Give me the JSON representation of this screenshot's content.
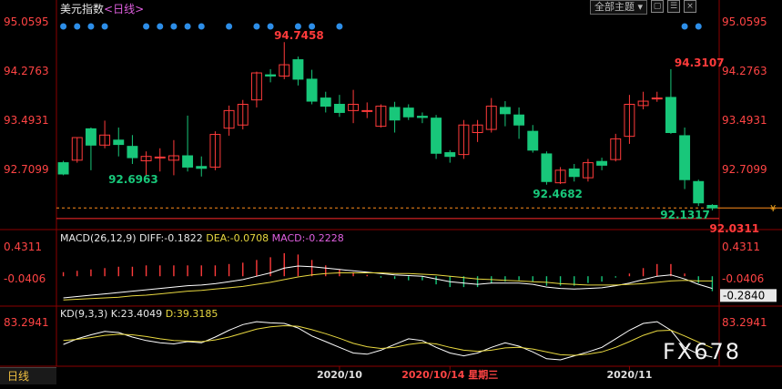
{
  "header": {
    "title": "美元指数",
    "period": "<日线>",
    "theme_label": "全部主题",
    "theme_arrow": "▾"
  },
  "colors": {
    "up": "#ff3b3b",
    "down": "#18c77a",
    "price_axis": "#ff4444",
    "diff": "#ffffff",
    "dea": "#e8d840",
    "macd": "#e060e0",
    "event_dot": "#2d8ee8"
  },
  "footer": {
    "tab_label": "日线",
    "watermark": "FX678"
  },
  "chart_data": [
    {
      "type": "candlestick",
      "title": "美元指数<日线>",
      "y_ticks": [
        95.0595,
        94.2763,
        93.4931,
        92.7099
      ],
      "ylim": [
        91.9,
        95.15
      ],
      "current_price": "92.0311",
      "reference_line": 91.93,
      "annotations": [
        {
          "text": "94.7458",
          "value": 94.7458,
          "index": 15
        },
        {
          "text": "92.6963",
          "value": 92.6963,
          "index": 3
        },
        {
          "text": "92.4682",
          "value": 92.4682,
          "index": 34
        },
        {
          "text": "94.3107",
          "value": 94.3107,
          "index": 44
        },
        {
          "text": "92.1317",
          "value": 92.1317,
          "index": 46
        },
        {
          "text": "92.0311",
          "value": 92.0311,
          "index": 47
        }
      ],
      "event_dot_indices": [
        0,
        1,
        2,
        3,
        6,
        7,
        8,
        9,
        10,
        12,
        14,
        15,
        17,
        18,
        20,
        45,
        46
      ],
      "x_labels": [
        {
          "text": "2020/10",
          "index": 20
        },
        {
          "text": "2020/10/14 星期三",
          "index": 28
        },
        {
          "text": "2020/11",
          "index": 41
        }
      ],
      "candles": [
        {
          "o": 92.82,
          "h": 92.85,
          "c": 92.64,
          "l": 92.62
        },
        {
          "o": 92.86,
          "h": 93.22,
          "c": 93.22,
          "l": 92.82
        },
        {
          "o": 93.36,
          "h": 93.38,
          "c": 93.1,
          "l": 92.7
        },
        {
          "o": 93.1,
          "h": 93.49,
          "c": 93.26,
          "l": 93.05
        },
        {
          "o": 93.18,
          "h": 93.38,
          "c": 93.11,
          "l": 92.92
        },
        {
          "o": 93.08,
          "h": 93.26,
          "c": 92.9,
          "l": 92.8
        },
        {
          "o": 92.85,
          "h": 93.0,
          "c": 92.92,
          "l": 92.62
        },
        {
          "o": 92.9,
          "h": 93.05,
          "c": 92.91,
          "l": 92.68
        },
        {
          "o": 92.86,
          "h": 93.18,
          "c": 92.93,
          "l": 92.62
        },
        {
          "o": 92.93,
          "h": 93.57,
          "c": 92.75,
          "l": 92.68
        },
        {
          "o": 92.76,
          "h": 92.92,
          "c": 92.73,
          "l": 92.6
        },
        {
          "o": 92.75,
          "h": 93.32,
          "c": 93.27,
          "l": 92.7
        },
        {
          "o": 93.37,
          "h": 93.73,
          "c": 93.65,
          "l": 93.25
        },
        {
          "o": 93.42,
          "h": 93.82,
          "c": 93.75,
          "l": 93.35
        },
        {
          "o": 93.82,
          "h": 94.27,
          "c": 94.25,
          "l": 93.7
        },
        {
          "o": 94.22,
          "h": 94.31,
          "c": 94.2,
          "l": 94.1
        },
        {
          "o": 94.2,
          "h": 94.74,
          "c": 94.38,
          "l": 94.15
        },
        {
          "o": 94.46,
          "h": 94.51,
          "c": 94.15,
          "l": 94.05
        },
        {
          "o": 94.15,
          "h": 94.3,
          "c": 93.8,
          "l": 93.75
        },
        {
          "o": 93.85,
          "h": 93.95,
          "c": 93.72,
          "l": 93.62
        },
        {
          "o": 93.75,
          "h": 93.9,
          "c": 93.62,
          "l": 93.55
        },
        {
          "o": 93.65,
          "h": 93.98,
          "c": 93.75,
          "l": 93.45
        },
        {
          "o": 93.65,
          "h": 93.78,
          "c": 93.65,
          "l": 93.53
        },
        {
          "o": 93.4,
          "h": 93.75,
          "c": 93.72,
          "l": 93.38
        },
        {
          "o": 93.7,
          "h": 93.79,
          "c": 93.5,
          "l": 93.3
        },
        {
          "o": 93.69,
          "h": 93.75,
          "c": 93.55,
          "l": 93.5
        },
        {
          "o": 93.56,
          "h": 93.62,
          "c": 93.54,
          "l": 93.45
        },
        {
          "o": 93.53,
          "h": 93.58,
          "c": 92.97,
          "l": 92.88
        },
        {
          "o": 92.98,
          "h": 93.02,
          "c": 92.92,
          "l": 92.82
        },
        {
          "o": 92.95,
          "h": 93.5,
          "c": 93.42,
          "l": 92.88
        },
        {
          "o": 93.3,
          "h": 93.5,
          "c": 93.42,
          "l": 93.15
        },
        {
          "o": 93.35,
          "h": 93.85,
          "c": 93.72,
          "l": 93.3
        },
        {
          "o": 93.7,
          "h": 93.8,
          "c": 93.6,
          "l": 93.4
        },
        {
          "o": 93.58,
          "h": 93.7,
          "c": 93.42,
          "l": 93.2
        },
        {
          "o": 93.32,
          "h": 93.42,
          "c": 93.02,
          "l": 92.98
        },
        {
          "o": 92.96,
          "h": 93.0,
          "c": 92.52,
          "l": 92.47
        },
        {
          "o": 92.5,
          "h": 92.75,
          "c": 92.7,
          "l": 92.48
        },
        {
          "o": 92.72,
          "h": 92.8,
          "c": 92.6,
          "l": 92.52
        },
        {
          "o": 92.58,
          "h": 92.88,
          "c": 92.82,
          "l": 92.52
        },
        {
          "o": 92.84,
          "h": 92.9,
          "c": 92.78,
          "l": 92.7
        },
        {
          "o": 92.87,
          "h": 93.28,
          "c": 93.2,
          "l": 92.84
        },
        {
          "o": 93.24,
          "h": 93.9,
          "c": 93.75,
          "l": 93.12
        },
        {
          "o": 93.73,
          "h": 93.95,
          "c": 93.8,
          "l": 93.67
        },
        {
          "o": 93.85,
          "h": 93.95,
          "c": 93.85,
          "l": 93.79
        },
        {
          "o": 93.86,
          "h": 94.31,
          "c": 93.3,
          "l": 93.28
        },
        {
          "o": 93.25,
          "h": 93.38,
          "c": 92.55,
          "l": 92.4
        },
        {
          "o": 92.52,
          "h": 92.55,
          "c": 92.18,
          "l": 92.13
        },
        {
          "o": 92.14,
          "h": 92.16,
          "c": 92.1,
          "l": 92.06
        }
      ]
    },
    {
      "type": "macd",
      "label": "MACD(26,12,9)",
      "diff_label": "DIFF:-0.1822",
      "dea_label": "DEA:-0.0708",
      "macd_label": "MACD:-0.2228",
      "y_ticks_right": [
        "0.4311",
        "-0.0406",
        "-0.2840"
      ],
      "y_ticks_left": [
        "0.4311",
        "-0.0406"
      ],
      "ylim": [
        -0.36,
        0.5
      ],
      "diff": [
        -0.32,
        -0.3,
        -0.28,
        -0.26,
        -0.24,
        -0.22,
        -0.2,
        -0.18,
        -0.16,
        -0.14,
        -0.13,
        -0.11,
        -0.08,
        -0.05,
        0.0,
        0.05,
        0.12,
        0.15,
        0.14,
        0.12,
        0.1,
        0.08,
        0.06,
        0.04,
        0.02,
        0.01,
        0.0,
        -0.04,
        -0.08,
        -0.1,
        -0.12,
        -0.1,
        -0.1,
        -0.1,
        -0.12,
        -0.16,
        -0.18,
        -0.19,
        -0.18,
        -0.17,
        -0.14,
        -0.1,
        -0.05,
        0.0,
        0.02,
        -0.04,
        -0.12,
        -0.18
      ],
      "dea": [
        -0.35,
        -0.34,
        -0.33,
        -0.32,
        -0.31,
        -0.29,
        -0.28,
        -0.26,
        -0.24,
        -0.22,
        -0.21,
        -0.19,
        -0.17,
        -0.15,
        -0.12,
        -0.09,
        -0.05,
        -0.01,
        0.02,
        0.04,
        0.05,
        0.05,
        0.05,
        0.05,
        0.04,
        0.04,
        0.03,
        0.02,
        0.0,
        -0.02,
        -0.04,
        -0.05,
        -0.06,
        -0.07,
        -0.08,
        -0.09,
        -0.11,
        -0.12,
        -0.13,
        -0.13,
        -0.13,
        -0.12,
        -0.11,
        -0.09,
        -0.07,
        -0.06,
        -0.07,
        -0.07
      ],
      "macd": [
        0.06,
        0.08,
        0.1,
        0.12,
        0.14,
        0.14,
        0.16,
        0.16,
        0.16,
        0.16,
        0.16,
        0.16,
        0.18,
        0.2,
        0.24,
        0.28,
        0.34,
        0.32,
        0.24,
        0.16,
        0.1,
        0.06,
        0.02,
        -0.02,
        -0.04,
        -0.06,
        -0.06,
        -0.12,
        -0.16,
        -0.16,
        -0.16,
        -0.1,
        -0.08,
        -0.06,
        -0.08,
        -0.14,
        -0.14,
        -0.14,
        -0.1,
        -0.08,
        -0.02,
        0.04,
        0.12,
        0.18,
        0.18,
        0.04,
        -0.1,
        -0.22
      ]
    },
    {
      "type": "kd",
      "label": "KD(9,3,3)",
      "k_label": "K:23.4049",
      "d_label": "D:39.3185",
      "y_ticks": [
        "83.2941"
      ],
      "ylim": [
        10,
        90
      ],
      "k": [
        45,
        55,
        62,
        68,
        66,
        58,
        52,
        48,
        46,
        50,
        48,
        58,
        70,
        80,
        85,
        83,
        82,
        74,
        60,
        50,
        40,
        30,
        28,
        35,
        45,
        55,
        52,
        40,
        30,
        25,
        30,
        40,
        48,
        42,
        32,
        20,
        18,
        25,
        32,
        40,
        55,
        70,
        82,
        85,
        70,
        40,
        28,
        23
      ],
      "d": [
        52,
        54,
        57,
        61,
        63,
        62,
        59,
        55,
        52,
        51,
        50,
        53,
        58,
        65,
        72,
        76,
        78,
        77,
        71,
        64,
        56,
        47,
        41,
        38,
        40,
        45,
        48,
        46,
        40,
        35,
        33,
        35,
        39,
        40,
        37,
        32,
        27,
        26,
        28,
        32,
        40,
        50,
        61,
        69,
        70,
        60,
        49,
        39
      ]
    }
  ]
}
